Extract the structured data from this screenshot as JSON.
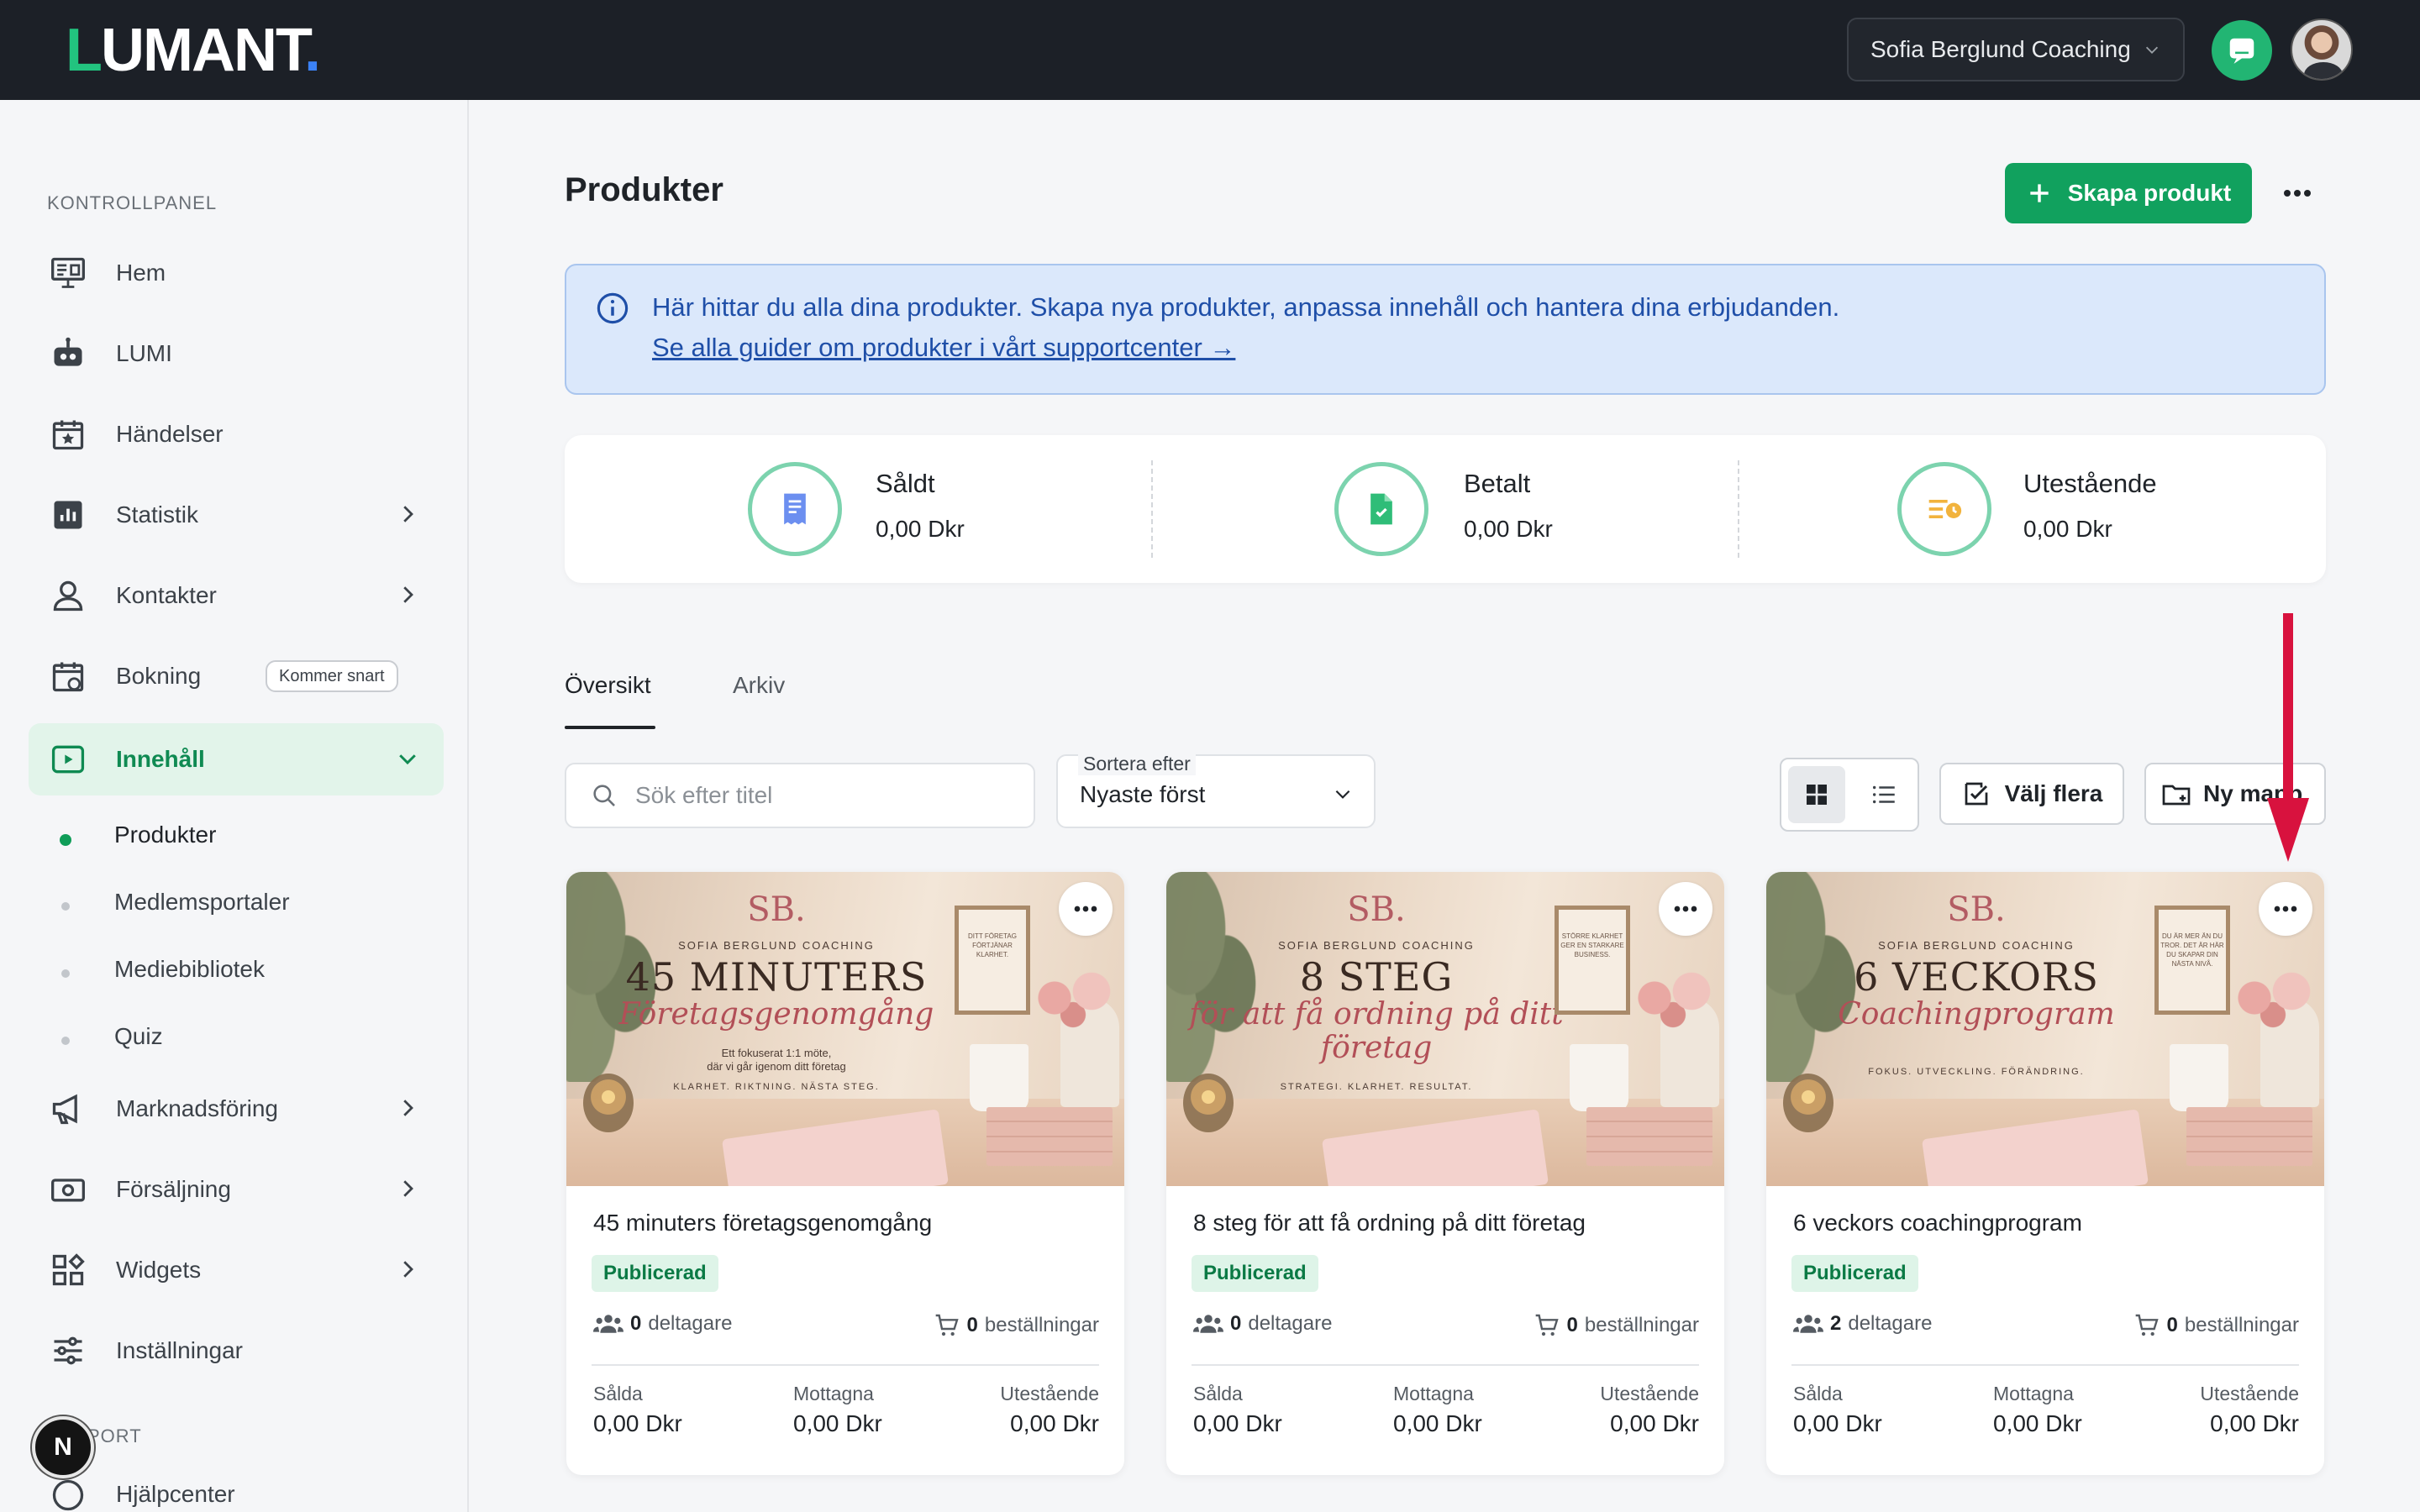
{
  "topbar": {
    "logo": "LUMANT",
    "account_name": "Sofia Berglund Coaching"
  },
  "sidebar": {
    "section_title": "KONTROLLPANEL",
    "items": [
      {
        "label": "Hem",
        "icon": "monitor-icon"
      },
      {
        "label": "LUMI",
        "icon": "robot-icon"
      },
      {
        "label": "Händelser",
        "icon": "calendar-star-icon"
      },
      {
        "label": "Statistik",
        "icon": "bar-chart-icon"
      },
      {
        "label": "Kontakter",
        "icon": "person-icon"
      },
      {
        "label": "Bokning",
        "icon": "calendar-sync-icon",
        "badge": "Kommer snart"
      },
      {
        "label": "Innehåll",
        "icon": "play-square-icon"
      },
      {
        "label": "Marknadsföring",
        "icon": "megaphone-icon"
      },
      {
        "label": "Försäljning",
        "icon": "cash-icon"
      },
      {
        "label": "Widgets",
        "icon": "widgets-icon"
      },
      {
        "label": "Inställningar",
        "icon": "sliders-icon"
      }
    ],
    "sub_items": [
      "Produkter",
      "Medlemsportaler",
      "Mediebibliotek",
      "Quiz"
    ],
    "support_title": "PORT",
    "help_label": "Hjälpcenter",
    "n_button": "N"
  },
  "main": {
    "title": "Produkter",
    "create_label": "Skapa produkt",
    "info_text": "Här hittar du alla dina produkter. Skapa nya produkter, anpassa innehåll och hantera dina erbjudanden.",
    "info_link": "Se alla guider om produkter i vårt supportcenter →",
    "stats": [
      {
        "label": "Såldt",
        "value": "0,00 Dkr"
      },
      {
        "label": "Betalt",
        "value": "0,00 Dkr"
      },
      {
        "label": "Utestående",
        "value": "0,00 Dkr"
      }
    ],
    "tabs": [
      "Översikt",
      "Arkiv"
    ],
    "search_placeholder": "Sök efter titel",
    "sort_label": "Sortera efter",
    "sort_value": "Nyaste först",
    "select_many": "Välj flera",
    "new_folder": "Ny mapp",
    "colors": {
      "accent": "#11a15e",
      "topbar": "#1c2027",
      "arrow": "#d8123e"
    }
  },
  "cards": [
    {
      "title": "45 minuters företagsgenomgång",
      "status": "Publicerad",
      "participants": "0",
      "participants_label": "deltagare",
      "orders": "0",
      "orders_label": "beställningar",
      "sold_label": "Sålda",
      "sold": "0,00 Dkr",
      "received_label": "Mottagna",
      "received": "0,00 Dkr",
      "outstanding_label": "Utestående",
      "outstanding": "0,00 Dkr",
      "thumb": {
        "logo": "SB.",
        "brand": "SOFIA BERGLUND COACHING",
        "big": "45 MINUTERS",
        "script": "Företagsgenomgång",
        "small1": "Ett fokuserat 1:1 möte,",
        "small2": "där vi går igenom ditt företag",
        "tag": "KLARHET. RIKTNING. NÄSTA STEG.",
        "frame": "DITT FÖRETAG FÖRTJÄNAR KLARHET."
      }
    },
    {
      "title": "8 steg för att få ordning på ditt företag",
      "status": "Publicerad",
      "participants": "0",
      "participants_label": "deltagare",
      "orders": "0",
      "orders_label": "beställningar",
      "sold_label": "Sålda",
      "sold": "0,00 Dkr",
      "received_label": "Mottagna",
      "received": "0,00 Dkr",
      "outstanding_label": "Utestående",
      "outstanding": "0,00 Dkr",
      "thumb": {
        "logo": "SB.",
        "brand": "SOFIA BERGLUND COACHING",
        "big": "8 STEG",
        "script": "för att få ordning på ditt företag",
        "small1": "",
        "small2": "",
        "tag": "STRATEGI. KLARHET. RESULTAT.",
        "frame": "STÖRRE KLARHET GER EN STARKARE BUSINESS."
      }
    },
    {
      "title": "6 veckors coachingprogram",
      "status": "Publicerad",
      "participants": "2",
      "participants_label": "deltagare",
      "orders": "0",
      "orders_label": "beställningar",
      "sold_label": "Sålda",
      "sold": "0,00 Dkr",
      "received_label": "Mottagna",
      "received": "0,00 Dkr",
      "outstanding_label": "Utestående",
      "outstanding": "0,00 Dkr",
      "thumb": {
        "logo": "SB.",
        "brand": "SOFIA BERGLUND COACHING",
        "big": "6 VECKORS",
        "script": "Coachingprogram",
        "small1": "",
        "small2": "",
        "tag": "FOKUS. UTVECKLING. FÖRÄNDRING.",
        "frame": "DU ÄR MER ÄN DU TROR. DET ÄR HÄR DU SKAPAR DIN NÄSTA NIVÅ."
      }
    }
  ]
}
